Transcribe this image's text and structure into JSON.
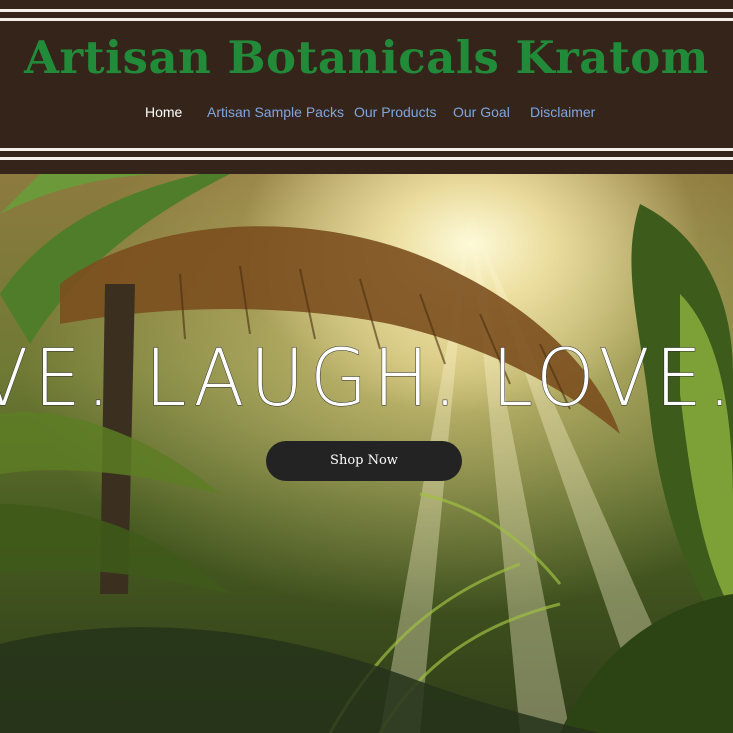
{
  "header": {
    "site_title": "Artisan Botanicals Kratom",
    "title_color": "#228b3a",
    "background": "#35241a"
  },
  "nav": {
    "items": [
      {
        "label": "Home",
        "active": true
      },
      {
        "label": "Artisan Sample Packs",
        "active": false
      },
      {
        "label": "Our Products",
        "active": false
      },
      {
        "label": "Our Goal",
        "active": false
      },
      {
        "label": "Disclaimer",
        "active": false
      }
    ],
    "link_color": "#7ea6e0",
    "active_color": "#ffffff"
  },
  "hero": {
    "headline": "IVE. LAUGH. LOVE. KRATOM",
    "cta_label": "Shop Now",
    "cta_color": "#232323"
  }
}
